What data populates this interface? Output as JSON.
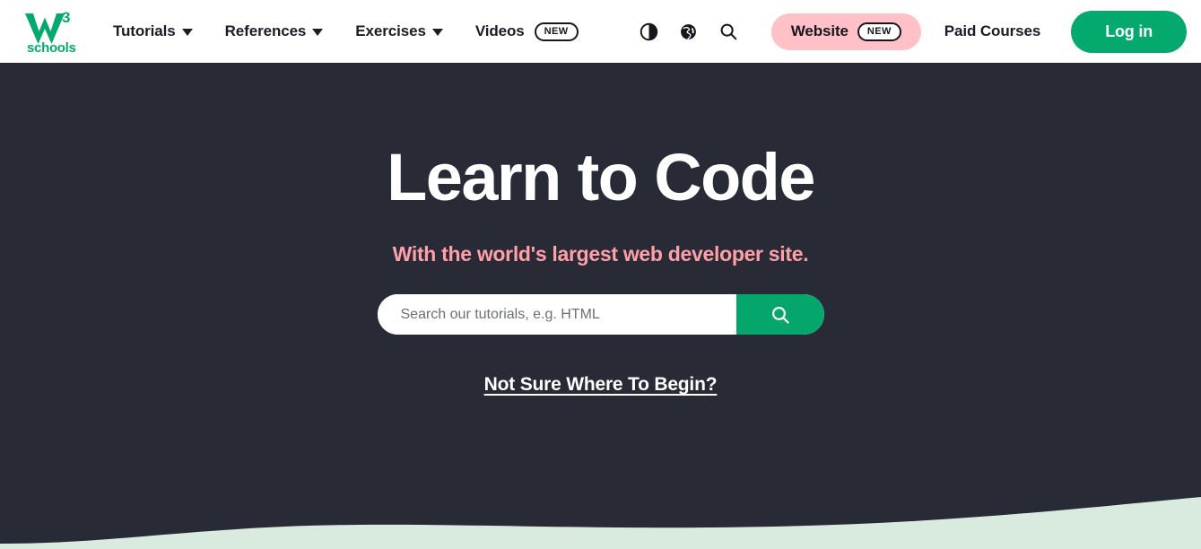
{
  "navbar": {
    "logo": {
      "name": "w3schools-logo",
      "mark": "W",
      "superscript": "3",
      "wordmark": "schools",
      "color": "#04aa6d"
    },
    "menu_items": [
      {
        "label": "Tutorials",
        "has_caret": true,
        "badge": null
      },
      {
        "label": "References",
        "has_caret": true,
        "badge": null
      },
      {
        "label": "Exercises",
        "has_caret": true,
        "badge": null
      },
      {
        "label": "Videos",
        "has_caret": false,
        "badge": "NEW"
      }
    ],
    "icons": [
      {
        "name": "dark-mode-icon",
        "title": "Toggle dark mode"
      },
      {
        "name": "globe-translate-icon",
        "title": "Change language"
      },
      {
        "name": "search-icon",
        "title": "Search"
      }
    ],
    "website_pill": {
      "label": "Website",
      "badge": "NEW",
      "bg_color": "#ffc0c7"
    },
    "paid_courses_label": "Paid Courses",
    "login_label": "Log in",
    "login_color": "#04aa6d"
  },
  "hero": {
    "title": "Learn to Code",
    "subtitle": "With the world's largest web developer site.",
    "subtitle_color": "#ffa0a8",
    "background_color": "#282a35",
    "search": {
      "placeholder": "Search our tutorials, e.g. HTML",
      "value": "",
      "button_icon": "search-icon",
      "button_color": "#04a66b"
    },
    "begin_link_label": "Not Sure Where To Begin?",
    "wave_color": "#d9eadf"
  }
}
